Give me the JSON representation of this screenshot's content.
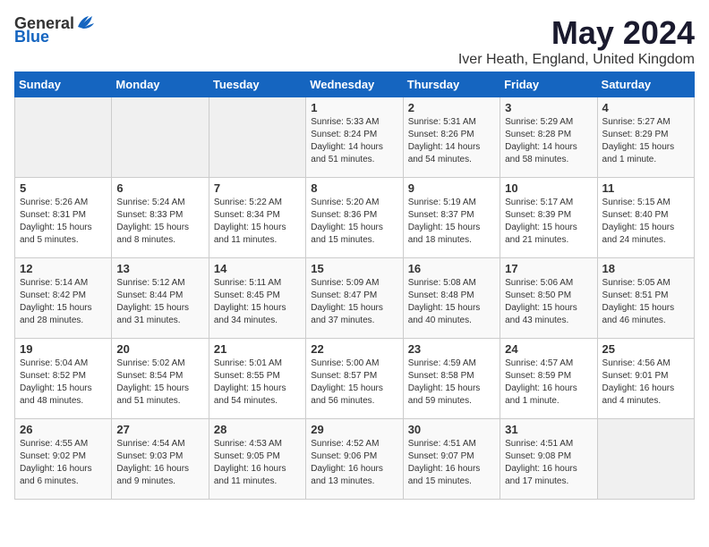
{
  "logo": {
    "general": "General",
    "blue": "Blue"
  },
  "header": {
    "month": "May 2024",
    "location": "Iver Heath, England, United Kingdom"
  },
  "days_of_week": [
    "Sunday",
    "Monday",
    "Tuesday",
    "Wednesday",
    "Thursday",
    "Friday",
    "Saturday"
  ],
  "weeks": [
    [
      {
        "day": "",
        "sunrise": "",
        "sunset": "",
        "daylight": ""
      },
      {
        "day": "",
        "sunrise": "",
        "sunset": "",
        "daylight": ""
      },
      {
        "day": "",
        "sunrise": "",
        "sunset": "",
        "daylight": ""
      },
      {
        "day": "1",
        "sunrise": "Sunrise: 5:33 AM",
        "sunset": "Sunset: 8:24 PM",
        "daylight": "Daylight: 14 hours and 51 minutes."
      },
      {
        "day": "2",
        "sunrise": "Sunrise: 5:31 AM",
        "sunset": "Sunset: 8:26 PM",
        "daylight": "Daylight: 14 hours and 54 minutes."
      },
      {
        "day": "3",
        "sunrise": "Sunrise: 5:29 AM",
        "sunset": "Sunset: 8:28 PM",
        "daylight": "Daylight: 14 hours and 58 minutes."
      },
      {
        "day": "4",
        "sunrise": "Sunrise: 5:27 AM",
        "sunset": "Sunset: 8:29 PM",
        "daylight": "Daylight: 15 hours and 1 minute."
      }
    ],
    [
      {
        "day": "5",
        "sunrise": "Sunrise: 5:26 AM",
        "sunset": "Sunset: 8:31 PM",
        "daylight": "Daylight: 15 hours and 5 minutes."
      },
      {
        "day": "6",
        "sunrise": "Sunrise: 5:24 AM",
        "sunset": "Sunset: 8:33 PM",
        "daylight": "Daylight: 15 hours and 8 minutes."
      },
      {
        "day": "7",
        "sunrise": "Sunrise: 5:22 AM",
        "sunset": "Sunset: 8:34 PM",
        "daylight": "Daylight: 15 hours and 11 minutes."
      },
      {
        "day": "8",
        "sunrise": "Sunrise: 5:20 AM",
        "sunset": "Sunset: 8:36 PM",
        "daylight": "Daylight: 15 hours and 15 minutes."
      },
      {
        "day": "9",
        "sunrise": "Sunrise: 5:19 AM",
        "sunset": "Sunset: 8:37 PM",
        "daylight": "Daylight: 15 hours and 18 minutes."
      },
      {
        "day": "10",
        "sunrise": "Sunrise: 5:17 AM",
        "sunset": "Sunset: 8:39 PM",
        "daylight": "Daylight: 15 hours and 21 minutes."
      },
      {
        "day": "11",
        "sunrise": "Sunrise: 5:15 AM",
        "sunset": "Sunset: 8:40 PM",
        "daylight": "Daylight: 15 hours and 24 minutes."
      }
    ],
    [
      {
        "day": "12",
        "sunrise": "Sunrise: 5:14 AM",
        "sunset": "Sunset: 8:42 PM",
        "daylight": "Daylight: 15 hours and 28 minutes."
      },
      {
        "day": "13",
        "sunrise": "Sunrise: 5:12 AM",
        "sunset": "Sunset: 8:44 PM",
        "daylight": "Daylight: 15 hours and 31 minutes."
      },
      {
        "day": "14",
        "sunrise": "Sunrise: 5:11 AM",
        "sunset": "Sunset: 8:45 PM",
        "daylight": "Daylight: 15 hours and 34 minutes."
      },
      {
        "day": "15",
        "sunrise": "Sunrise: 5:09 AM",
        "sunset": "Sunset: 8:47 PM",
        "daylight": "Daylight: 15 hours and 37 minutes."
      },
      {
        "day": "16",
        "sunrise": "Sunrise: 5:08 AM",
        "sunset": "Sunset: 8:48 PM",
        "daylight": "Daylight: 15 hours and 40 minutes."
      },
      {
        "day": "17",
        "sunrise": "Sunrise: 5:06 AM",
        "sunset": "Sunset: 8:50 PM",
        "daylight": "Daylight: 15 hours and 43 minutes."
      },
      {
        "day": "18",
        "sunrise": "Sunrise: 5:05 AM",
        "sunset": "Sunset: 8:51 PM",
        "daylight": "Daylight: 15 hours and 46 minutes."
      }
    ],
    [
      {
        "day": "19",
        "sunrise": "Sunrise: 5:04 AM",
        "sunset": "Sunset: 8:52 PM",
        "daylight": "Daylight: 15 hours and 48 minutes."
      },
      {
        "day": "20",
        "sunrise": "Sunrise: 5:02 AM",
        "sunset": "Sunset: 8:54 PM",
        "daylight": "Daylight: 15 hours and 51 minutes."
      },
      {
        "day": "21",
        "sunrise": "Sunrise: 5:01 AM",
        "sunset": "Sunset: 8:55 PM",
        "daylight": "Daylight: 15 hours and 54 minutes."
      },
      {
        "day": "22",
        "sunrise": "Sunrise: 5:00 AM",
        "sunset": "Sunset: 8:57 PM",
        "daylight": "Daylight: 15 hours and 56 minutes."
      },
      {
        "day": "23",
        "sunrise": "Sunrise: 4:59 AM",
        "sunset": "Sunset: 8:58 PM",
        "daylight": "Daylight: 15 hours and 59 minutes."
      },
      {
        "day": "24",
        "sunrise": "Sunrise: 4:57 AM",
        "sunset": "Sunset: 8:59 PM",
        "daylight": "Daylight: 16 hours and 1 minute."
      },
      {
        "day": "25",
        "sunrise": "Sunrise: 4:56 AM",
        "sunset": "Sunset: 9:01 PM",
        "daylight": "Daylight: 16 hours and 4 minutes."
      }
    ],
    [
      {
        "day": "26",
        "sunrise": "Sunrise: 4:55 AM",
        "sunset": "Sunset: 9:02 PM",
        "daylight": "Daylight: 16 hours and 6 minutes."
      },
      {
        "day": "27",
        "sunrise": "Sunrise: 4:54 AM",
        "sunset": "Sunset: 9:03 PM",
        "daylight": "Daylight: 16 hours and 9 minutes."
      },
      {
        "day": "28",
        "sunrise": "Sunrise: 4:53 AM",
        "sunset": "Sunset: 9:05 PM",
        "daylight": "Daylight: 16 hours and 11 minutes."
      },
      {
        "day": "29",
        "sunrise": "Sunrise: 4:52 AM",
        "sunset": "Sunset: 9:06 PM",
        "daylight": "Daylight: 16 hours and 13 minutes."
      },
      {
        "day": "30",
        "sunrise": "Sunrise: 4:51 AM",
        "sunset": "Sunset: 9:07 PM",
        "daylight": "Daylight: 16 hours and 15 minutes."
      },
      {
        "day": "31",
        "sunrise": "Sunrise: 4:51 AM",
        "sunset": "Sunset: 9:08 PM",
        "daylight": "Daylight: 16 hours and 17 minutes."
      },
      {
        "day": "",
        "sunrise": "",
        "sunset": "",
        "daylight": ""
      }
    ]
  ]
}
